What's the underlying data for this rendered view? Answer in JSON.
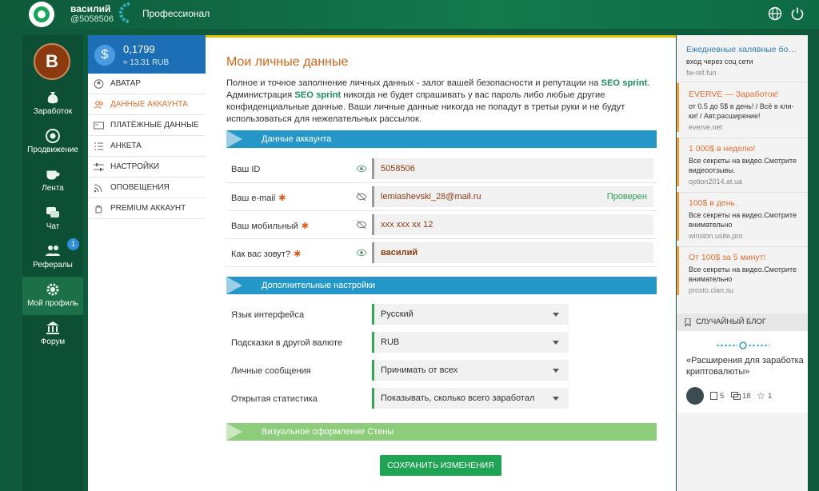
{
  "header": {
    "username": "василий",
    "user_id": "@5058506",
    "status": "Профессионал"
  },
  "nav": {
    "avatar_letter": "В",
    "items": [
      {
        "label": "Заработок",
        "icon": "money-bag-icon"
      },
      {
        "label": "Продвижение",
        "icon": "target-icon"
      },
      {
        "label": "Лента",
        "icon": "cup-icon"
      },
      {
        "label": "Чат",
        "icon": "chat-icon"
      },
      {
        "label": "Рефералы",
        "icon": "people-icon",
        "badge": "1"
      },
      {
        "label": "Мой профиль",
        "icon": "gear-icon"
      },
      {
        "label": "Форум",
        "icon": "forum-icon"
      }
    ]
  },
  "balance": {
    "amount": "0,1799",
    "rub": "≈ 13.31 RUB"
  },
  "submenu": [
    {
      "label": "Аватар",
      "icon": "user-icon"
    },
    {
      "label": "Данные аккаунта",
      "icon": "users-icon",
      "active": true
    },
    {
      "label": "Платёжные данные",
      "icon": "wallet-icon"
    },
    {
      "label": "Анкета",
      "icon": "list-icon"
    },
    {
      "label": "Настройки",
      "icon": "sliders-icon"
    },
    {
      "label": "Оповещения",
      "icon": "rss-icon"
    },
    {
      "label": "Premium аккаунт",
      "icon": "hand-icon"
    }
  ],
  "main": {
    "title": "Мои личные данные",
    "intro_1": "Полное и точное заполнение личных данных - залог вашей безопасности и репутации на ",
    "intro_brand": "SEO sprint",
    "intro_2": ". Администрация ",
    "intro_3": " никогда не будет спрашивать у вас пароль либо любые другие конфиденциальные данные. Ваши личные данные никогда не попадут в третьи руки и не будут использоваться для нежелательных рассылок.",
    "section_account": "Данные аккаунта",
    "fields": [
      {
        "label": "Ваш ID",
        "required": false,
        "value": "5058506"
      },
      {
        "label": "Ваш e-mail",
        "required": true,
        "value": "lemiashevski_28@mail.ru",
        "status": "Проверен"
      },
      {
        "label": "Ваш мобильный",
        "required": true,
        "value": "xxx xxx xx 12"
      },
      {
        "label": "Как вас зовут?",
        "required": true,
        "value": "василий"
      }
    ],
    "required_mark": "✱",
    "section_extra": "Дополнительные настройки",
    "selects": [
      {
        "label": "Язык интерфейса",
        "value": "Русский"
      },
      {
        "label": "Подсказки в другой валюте",
        "value": "RUB"
      },
      {
        "label": "Личные сообщения",
        "value": "Принимать от всех"
      },
      {
        "label": "Открытая статистика",
        "value": "Показывать, сколько всего заработал"
      }
    ],
    "section_wall": "Визуальное оформление Стены",
    "save_label": "Сохранить изменения"
  },
  "ads": [
    {
      "title": "Ежедневные халявные бо…",
      "text": "вход через соц сети",
      "url": "fw-ref.fun"
    },
    {
      "title": "EVERVE — Заработок!",
      "text": "от 0.5 до 5$ в день! / Всё в кли-ки! / Авт.расширение!",
      "url": "everve.net"
    },
    {
      "title": "1 000$ в неделю!",
      "text": "Все секреты на видео.Смотрите видеоотзывы.",
      "url": "option2014.at.ua"
    },
    {
      "title": "100$ в день.",
      "text": "Все секреты на видео.Смотрите внимательно",
      "url": "winston.usite.pro"
    },
    {
      "title": "От 100$ за 5 минут!",
      "text": "Все секреты на видео.Смотрите внимательно",
      "url": "prosto.clan.su"
    }
  ],
  "blog": {
    "header": "Случайный блог",
    "title": "«Расширения для заработка криптовалюты»",
    "posts": "5",
    "comments": "18",
    "stars": "1"
  }
}
